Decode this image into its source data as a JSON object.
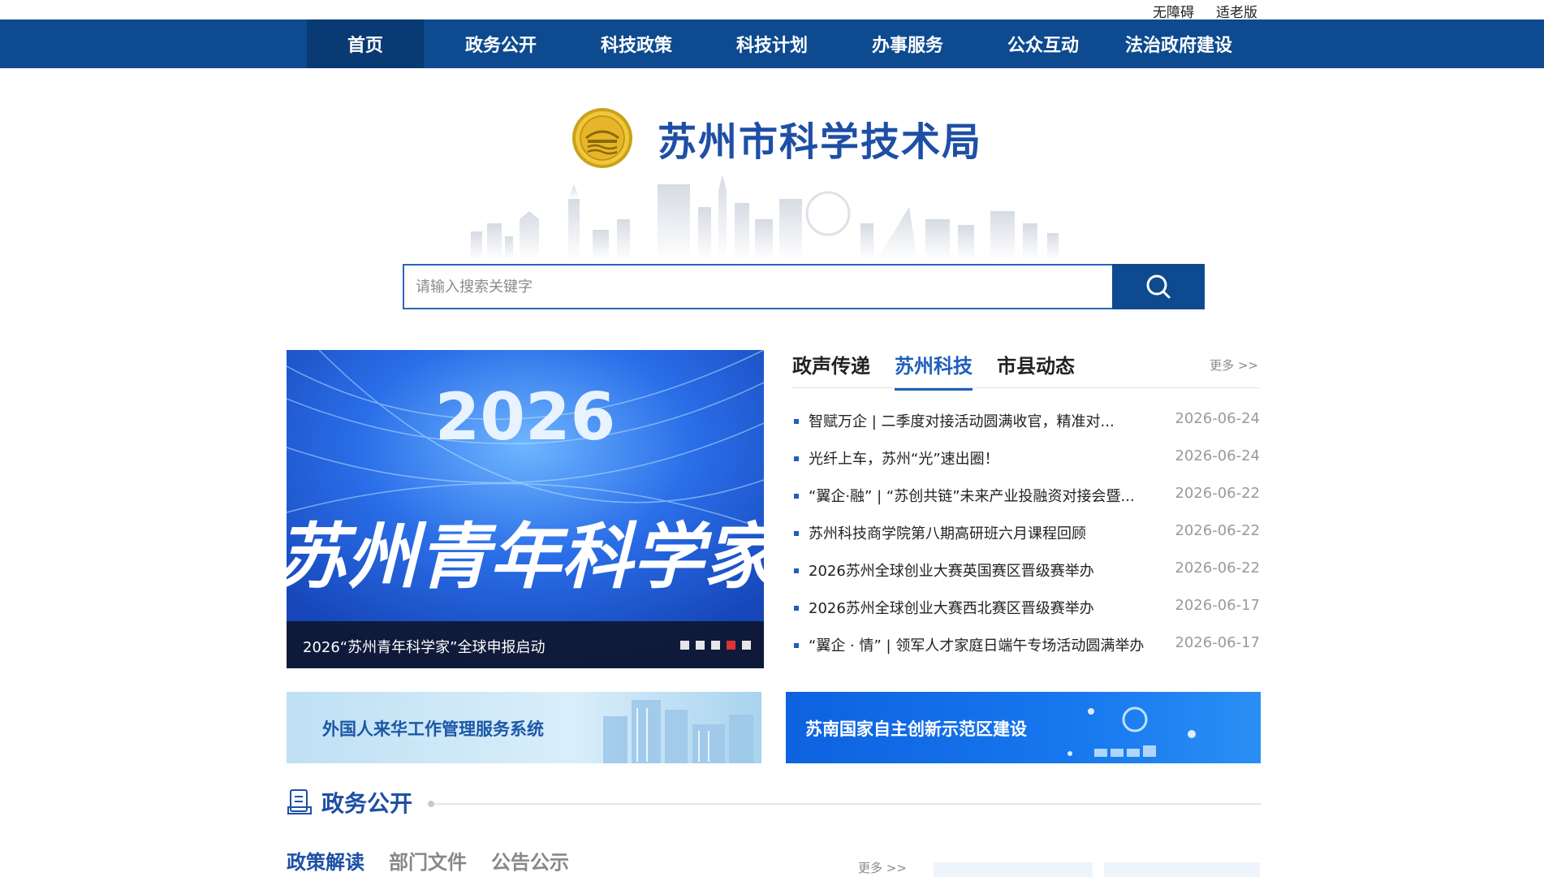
{
  "utility": {
    "accessibility": "无障碍",
    "elderly": "适老版"
  },
  "nav": {
    "items": [
      "首页",
      "政务公开",
      "科技政策",
      "科技计划",
      "办事服务",
      "公众互动",
      "法治政府建设"
    ]
  },
  "brand": {
    "title": "苏州市科学技术局"
  },
  "search": {
    "placeholder": "请输入搜索关键字"
  },
  "carousel": {
    "caption": "2026“苏州青年科学家”全球申报启动",
    "slide_year": "2026",
    "slide_title": "苏州青年科学家",
    "active_dot": 3
  },
  "news": {
    "tabs": [
      "政声传递",
      "苏州科技",
      "市县动态"
    ],
    "active_tab": 1,
    "more": "更多 >>",
    "items": [
      {
        "title": "智赋万企 | 二季度对接活动圆满收官，精准对...",
        "date": "2026-06-24"
      },
      {
        "title": "光纤上车，苏州“光”速出圈！",
        "date": "2026-06-24"
      },
      {
        "title": "“翼企·融” | “苏创共链”未来产业投融资对接会暨...",
        "date": "2026-06-22"
      },
      {
        "title": "苏州科技商学院第八期高研班六月课程回顾",
        "date": "2026-06-22"
      },
      {
        "title": "2026苏州全球创业大赛英国赛区晋级赛举办",
        "date": "2026-06-22"
      },
      {
        "title": "2026苏州全球创业大赛西北赛区晋级赛举办",
        "date": "2026-06-17"
      },
      {
        "title": "“翼企 · 情” | 领军人才家庭日端午专场活动圆满举办",
        "date": "2026-06-17"
      }
    ]
  },
  "banners": {
    "left": "外国人来华工作管理服务系统",
    "right": "苏南国家自主创新示范区建设"
  },
  "section": {
    "title": "政务公开",
    "sub_tabs": [
      "政策解读",
      "部门文件",
      "公告公示"
    ],
    "more": "更多 >>"
  },
  "colors": {
    "nav": "#0d4a8f",
    "accent": "#1e5fbd",
    "title": "#1e4fa6",
    "dot_active": "#dd3333"
  }
}
